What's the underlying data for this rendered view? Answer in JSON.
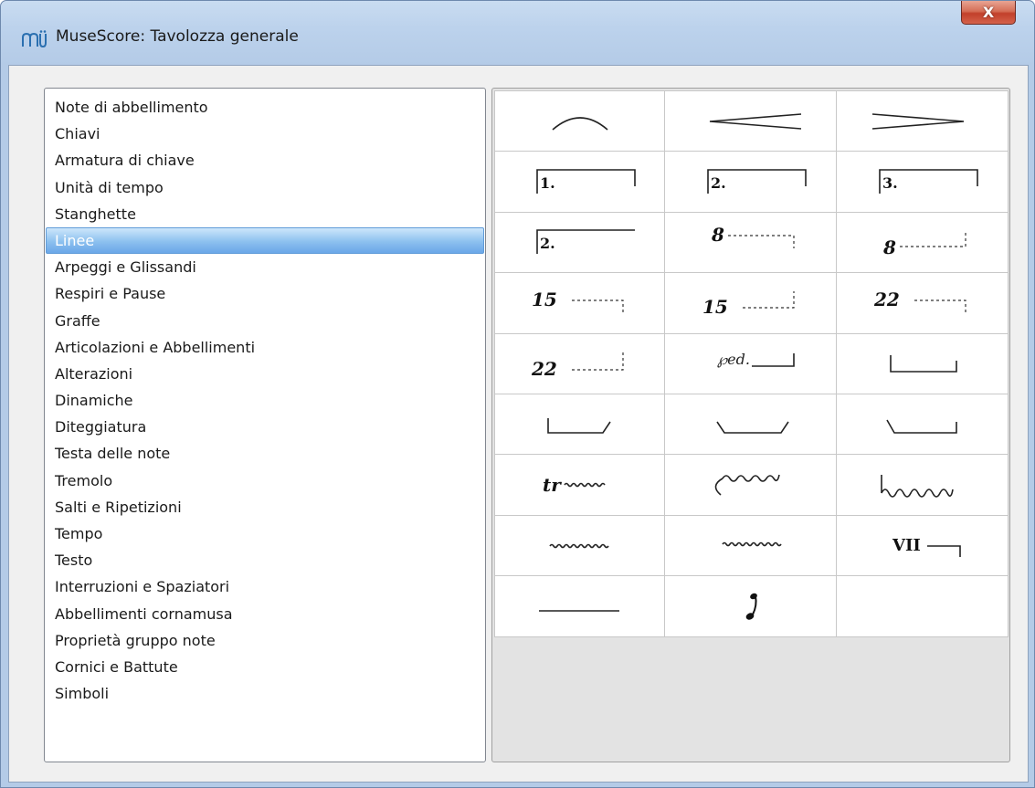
{
  "window": {
    "title": "MuseScore: Tavolozza generale",
    "close_label": "X",
    "icon": "musescore-app-icon"
  },
  "categories": {
    "selected": "Linee",
    "items": [
      {
        "label": "Note di abbellimento"
      },
      {
        "label": "Chiavi"
      },
      {
        "label": "Armatura di chiave"
      },
      {
        "label": "Unità di tempo"
      },
      {
        "label": "Stanghette"
      },
      {
        "label": "Linee"
      },
      {
        "label": "Arpeggi e Glissandi"
      },
      {
        "label": "Respiri e Pause"
      },
      {
        "label": "Graffe"
      },
      {
        "label": "Articolazioni e Abbellimenti"
      },
      {
        "label": "Alterazioni"
      },
      {
        "label": "Dinamiche"
      },
      {
        "label": "Diteggiatura"
      },
      {
        "label": "Testa delle note"
      },
      {
        "label": "Tremolo"
      },
      {
        "label": "Salti e Ripetizioni"
      },
      {
        "label": "Tempo"
      },
      {
        "label": "Testo"
      },
      {
        "label": "Interruzioni e Spaziatori"
      },
      {
        "label": "Abbellimenti cornamusa"
      },
      {
        "label": "Proprietà gruppo note"
      },
      {
        "label": "Cornici e Battute"
      },
      {
        "label": "Simboli"
      }
    ]
  },
  "palette": {
    "symbols": [
      {
        "name": "slur-icon"
      },
      {
        "name": "crescendo-hairpin-icon"
      },
      {
        "name": "diminuendo-hairpin-icon"
      },
      {
        "name": "volta-1-icon",
        "text": "1."
      },
      {
        "name": "volta-2-icon",
        "text": "2."
      },
      {
        "name": "volta-3-icon",
        "text": "3."
      },
      {
        "name": "volta-2-open-icon",
        "text": "2."
      },
      {
        "name": "ottava-8va-icon",
        "text": "8"
      },
      {
        "name": "ottava-8vb-icon",
        "text": "8"
      },
      {
        "name": "ottava-15ma-icon",
        "text": "15"
      },
      {
        "name": "ottava-15mb-icon",
        "text": "15"
      },
      {
        "name": "ottava-22ma-icon",
        "text": "22"
      },
      {
        "name": "ottava-22mb-icon",
        "text": "22"
      },
      {
        "name": "pedal-line-icon",
        "text": "𝆮"
      },
      {
        "name": "pedal-bracket-icon"
      },
      {
        "name": "pedal-bracket-angled-end-icon"
      },
      {
        "name": "pedal-bracket-angled-both-icon"
      },
      {
        "name": "pedal-bracket-angled-start-icon"
      },
      {
        "name": "trill-line-icon",
        "text": "tr"
      },
      {
        "name": "upprall-line-icon"
      },
      {
        "name": "downprall-line-icon"
      },
      {
        "name": "prallprall-line-icon"
      },
      {
        "name": "wavy-line-icon"
      },
      {
        "name": "string-number-line-icon",
        "text": "VII"
      },
      {
        "name": "text-line-icon"
      },
      {
        "name": "note-anchored-line-icon"
      },
      {
        "name": "empty-cell"
      }
    ]
  }
}
